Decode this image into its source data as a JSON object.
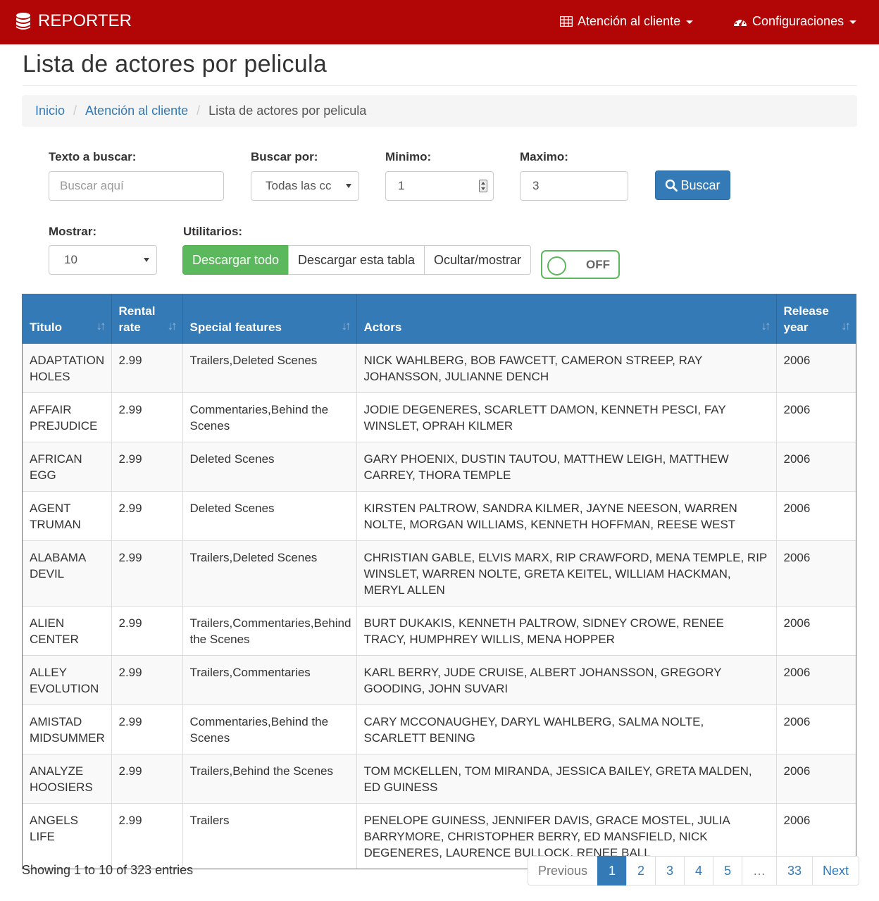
{
  "navbar": {
    "brand": "REPORTER",
    "menu1": "Atención al cliente",
    "menu2": "Configuraciones",
    "bg_color": "#b20505"
  },
  "page_title": "Lista de actores por pelicula",
  "breadcrumb": [
    "Inicio",
    "Atención al cliente",
    "Lista de actores por pelicula"
  ],
  "filters": {
    "search_label": "Texto a buscar:",
    "search_placeholder": "Buscar aquí",
    "search_by_label": "Buscar por:",
    "search_by_value": "Todas las cc",
    "min_label": "Minimo:",
    "min_value": "1",
    "max_label": "Maximo:",
    "max_value": "3",
    "search_button": "Buscar",
    "show_label": "Mostrar:",
    "show_value": "10",
    "utils_label": "Utilitarios:",
    "download_all": "Descargar todo",
    "download_table": "Descargar esta tabla",
    "hide_show": "Ocultar/mostrar",
    "toggle_state": "OFF"
  },
  "table": {
    "headers": {
      "title": "Titulo",
      "rental": "Rental rate",
      "features": "Special features",
      "actors": "Actors",
      "year": "Release year"
    },
    "rows": [
      {
        "title": "ADAPTATION HOLES",
        "rental": "2.99",
        "features": "Trailers,Deleted Scenes",
        "actors": "NICK WAHLBERG, BOB FAWCETT, CAMERON STREEP, RAY JOHANSSON, JULIANNE DENCH",
        "year": "2006"
      },
      {
        "title": "AFFAIR PREJUDICE",
        "rental": "2.99",
        "features": "Commentaries,Behind the Scenes",
        "actors": "JODIE DEGENERES, SCARLETT DAMON, KENNETH PESCI, FAY WINSLET, OPRAH KILMER",
        "year": "2006"
      },
      {
        "title": "AFRICAN EGG",
        "rental": "2.99",
        "features": "Deleted Scenes",
        "actors": "GARY PHOENIX, DUSTIN TAUTOU, MATTHEW LEIGH, MATTHEW CARREY, THORA TEMPLE",
        "year": "2006"
      },
      {
        "title": "AGENT TRUMAN",
        "rental": "2.99",
        "features": "Deleted Scenes",
        "actors": "KIRSTEN PALTROW, SANDRA KILMER, JAYNE NEESON, WARREN NOLTE, MORGAN WILLIAMS, KENNETH HOFFMAN, REESE WEST",
        "year": "2006"
      },
      {
        "title": "ALABAMA DEVIL",
        "rental": "2.99",
        "features": "Trailers,Deleted Scenes",
        "actors": "CHRISTIAN GABLE, ELVIS MARX, RIP CRAWFORD, MENA TEMPLE, RIP WINSLET, WARREN NOLTE, GRETA KEITEL, WILLIAM HACKMAN, MERYL ALLEN",
        "year": "2006"
      },
      {
        "title": "ALIEN CENTER",
        "rental": "2.99",
        "features": "Trailers,Commentaries,Behind the Scenes",
        "actors": "BURT DUKAKIS, KENNETH PALTROW, SIDNEY CROWE, RENEE TRACY, HUMPHREY WILLIS, MENA HOPPER",
        "year": "2006"
      },
      {
        "title": "ALLEY EVOLUTION",
        "rental": "2.99",
        "features": "Trailers,Commentaries",
        "actors": "KARL BERRY, JUDE CRUISE, ALBERT JOHANSSON, GREGORY GOODING, JOHN SUVARI",
        "year": "2006"
      },
      {
        "title": "AMISTAD MIDSUMMER",
        "rental": "2.99",
        "features": "Commentaries,Behind the Scenes",
        "actors": "CARY MCCONAUGHEY, DARYL WAHLBERG, SALMA NOLTE, SCARLETT BENING",
        "year": "2006"
      },
      {
        "title": "ANALYZE HOOSIERS",
        "rental": "2.99",
        "features": "Trailers,Behind the Scenes",
        "actors": "TOM MCKELLEN, TOM MIRANDA, JESSICA BAILEY, GRETA MALDEN, ED GUINESS",
        "year": "2006"
      },
      {
        "title": "ANGELS LIFE",
        "rental": "2.99",
        "features": "Trailers",
        "actors": "PENELOPE GUINESS, JENNIFER DAVIS, GRACE MOSTEL, JULIA BARRYMORE, CHRISTOPHER BERRY, ED MANSFIELD, NICK DEGENERES, LAURENCE BULLOCK, RENEE BALL",
        "year": "2006"
      }
    ]
  },
  "footer": {
    "info": "Showing 1 to 10 of 323 entries",
    "previous": "Previous",
    "pages": [
      "1",
      "2",
      "3",
      "4",
      "5",
      "…",
      "33"
    ],
    "next": "Next",
    "active_page": "1"
  }
}
